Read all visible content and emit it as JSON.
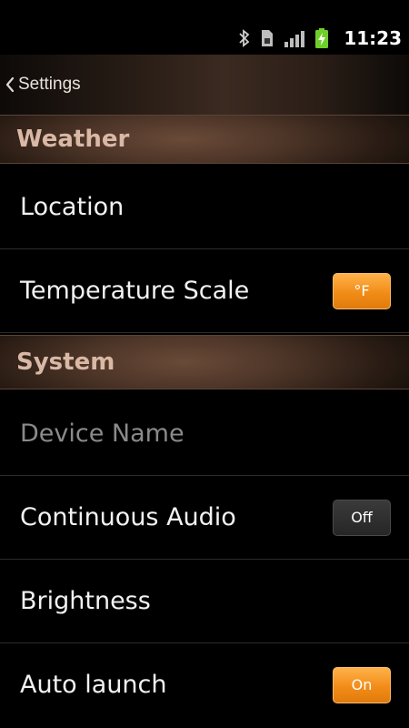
{
  "status_bar": {
    "time": "11:23",
    "icons": [
      "bluetooth-icon",
      "sim-card-icon",
      "signal-strength-icon",
      "battery-charging-icon"
    ]
  },
  "header": {
    "back_label": "Settings",
    "icon": "chevron-left-icon"
  },
  "sections": [
    {
      "label": "Weather",
      "items": [
        {
          "label": "Location"
        },
        {
          "label": "Temperature Scale",
          "value": "°F"
        }
      ]
    },
    {
      "label": "System",
      "items": [
        {
          "label": "Device Name"
        },
        {
          "label": "Continuous Audio",
          "value": "Off"
        },
        {
          "label": "Brightness"
        },
        {
          "label": "Auto launch",
          "value": "On"
        }
      ]
    }
  ],
  "colors": {
    "accent_orange": "#f28c18",
    "section_text": "#d9b8a6",
    "disabled_text": "#8a8a8a"
  }
}
